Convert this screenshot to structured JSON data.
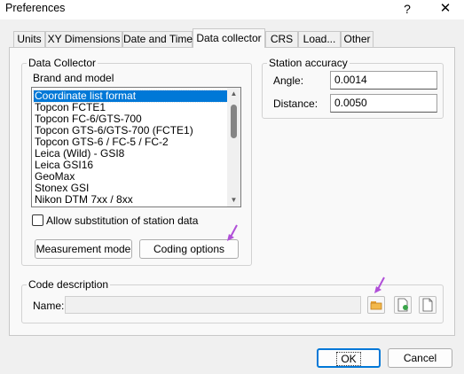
{
  "window": {
    "title": "Preferences",
    "help": "?",
    "close": "✕"
  },
  "tabs": [
    "Units",
    "XY Dimensions",
    "Date and Time",
    "Data collector",
    "CRS",
    "Load...",
    "Other"
  ],
  "data_collector": {
    "group_title": "Data Collector",
    "brand_label": "Brand and model",
    "items": [
      "Coordinate list format",
      "Topcon FCTE1",
      "Topcon FC-6/GTS-700",
      "Topcon GTS-6/GTS-700 (FCTE1)",
      "Topcon GTS-6 / FC-5 / FC-2",
      "Leica (Wild) - GSI8",
      "Leica GSI16",
      "GeoMax",
      "Stonex GSI",
      "Nikon DTM 7xx / 8xx"
    ],
    "selected": "Coordinate list format",
    "allow_label": "Allow substitution of station data",
    "allow_checked": false,
    "measurement_mode_label": "Measurement mode",
    "coding_options_label": "Coding options"
  },
  "station_accuracy": {
    "title": "Station accuracy",
    "angle_label": "Angle:",
    "angle_value": "0.0014",
    "distance_label": "Distance:",
    "distance_value": "0.0050"
  },
  "code_description": {
    "title": "Code description",
    "name_label": "Name:",
    "name_value": ""
  },
  "footer": {
    "ok_label": "OK",
    "cancel_label": "Cancel"
  },
  "colors": {
    "selection": "#0078d7",
    "annotation_arrow": "#b04fd8",
    "folder_icon": "#e8a33a"
  }
}
